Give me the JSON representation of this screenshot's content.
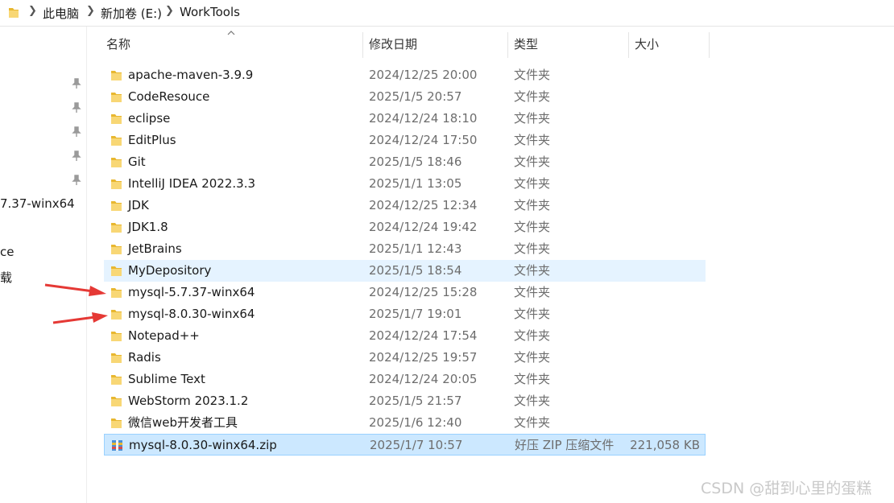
{
  "address": {
    "crumbs": [
      "此电脑",
      "新加卷 (E:)",
      "WorkTools"
    ],
    "separator": ">"
  },
  "nav": {
    "partial_items": [
      "7.37-winx64",
      "ce",
      "载"
    ]
  },
  "columns": {
    "name": "名称",
    "date": "修改日期",
    "type": "类型",
    "size": "大小"
  },
  "files": [
    {
      "name": "apache-maven-3.9.9",
      "date": "2024/12/25 20:00",
      "type": "文件夹",
      "size": "",
      "icon": "folder-icon"
    },
    {
      "name": "CodeResouce",
      "date": "2025/1/5 20:57",
      "type": "文件夹",
      "size": "",
      "icon": "folder-icon"
    },
    {
      "name": "eclipse",
      "date": "2024/12/24 18:10",
      "type": "文件夹",
      "size": "",
      "icon": "folder-icon"
    },
    {
      "name": "EditPlus",
      "date": "2024/12/24 17:50",
      "type": "文件夹",
      "size": "",
      "icon": "folder-icon"
    },
    {
      "name": "Git",
      "date": "2025/1/5 18:46",
      "type": "文件夹",
      "size": "",
      "icon": "folder-icon"
    },
    {
      "name": "IntelliJ IDEA 2022.3.3",
      "date": "2025/1/1 13:05",
      "type": "文件夹",
      "size": "",
      "icon": "folder-icon"
    },
    {
      "name": "JDK",
      "date": "2024/12/25 12:34",
      "type": "文件夹",
      "size": "",
      "icon": "folder-icon"
    },
    {
      "name": "JDK1.8",
      "date": "2024/12/24 19:42",
      "type": "文件夹",
      "size": "",
      "icon": "folder-icon"
    },
    {
      "name": "JetBrains",
      "date": "2025/1/1 12:43",
      "type": "文件夹",
      "size": "",
      "icon": "folder-icon"
    },
    {
      "name": "MyDepository",
      "date": "2025/1/5 18:54",
      "type": "文件夹",
      "size": "",
      "icon": "folder-icon"
    },
    {
      "name": "mysql-5.7.37-winx64",
      "date": "2024/12/25 15:28",
      "type": "文件夹",
      "size": "",
      "icon": "folder-icon"
    },
    {
      "name": "mysql-8.0.30-winx64",
      "date": "2025/1/7 19:01",
      "type": "文件夹",
      "size": "",
      "icon": "folder-icon"
    },
    {
      "name": "Notepad++",
      "date": "2024/12/24 17:54",
      "type": "文件夹",
      "size": "",
      "icon": "folder-icon"
    },
    {
      "name": "Radis",
      "date": "2024/12/25 19:57",
      "type": "文件夹",
      "size": "",
      "icon": "folder-icon"
    },
    {
      "name": "Sublime Text",
      "date": "2024/12/24 20:05",
      "type": "文件夹",
      "size": "",
      "icon": "folder-icon"
    },
    {
      "name": "WebStorm 2023.1.2",
      "date": "2025/1/5 21:57",
      "type": "文件夹",
      "size": "",
      "icon": "folder-icon"
    },
    {
      "name": "微信web开发者工具",
      "date": "2025/1/6 12:40",
      "type": "文件夹",
      "size": "",
      "icon": "folder-icon"
    },
    {
      "name": "mysql-8.0.30-winx64.zip",
      "date": "2025/1/7 10:57",
      "type": "好压 ZIP 压缩文件",
      "size": "221,058 KB",
      "icon": "zip-archive-icon"
    }
  ],
  "hover_row": 9,
  "selected_row": 17,
  "watermark": "CSDN @甜到心里的蛋糕",
  "colors": {
    "hover": "#e5f3ff",
    "selected": "#cce8ff",
    "selected_border": "#99d1ff",
    "folder": "#f8d775",
    "annotation_arrow": "#e53935"
  }
}
